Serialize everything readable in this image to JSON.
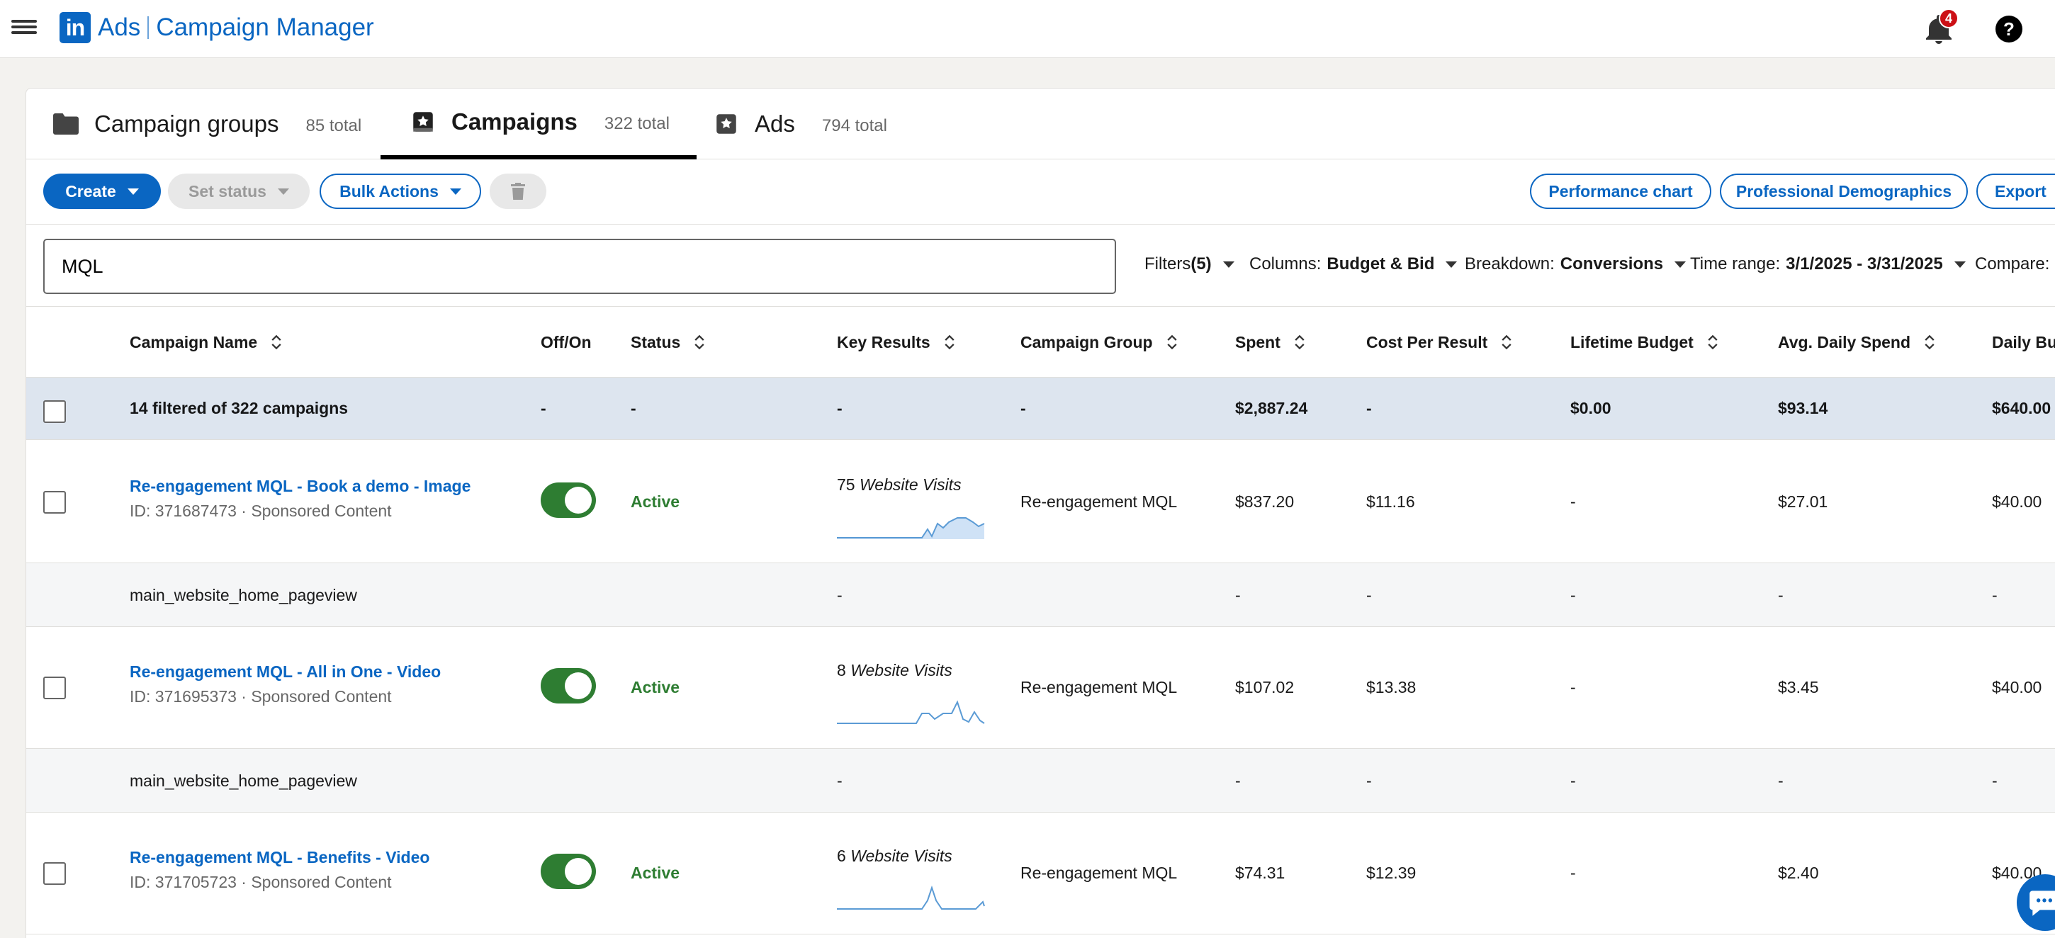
{
  "app": {
    "logo_text": "in",
    "product": "Ads",
    "name": "Campaign Manager",
    "notifications_count": "4",
    "help_label": "?"
  },
  "tabs": [
    {
      "label": "Campaign groups",
      "count": "85 total",
      "icon": "folder-icon"
    },
    {
      "label": "Campaigns",
      "count": "322 total",
      "icon": "campaign-star-icon"
    },
    {
      "label": "Ads",
      "count": "794 total",
      "icon": "ad-star-icon"
    }
  ],
  "toolbar": {
    "create": "Create",
    "set_status": "Set status",
    "bulk_actions": "Bulk Actions",
    "performance_chart": "Performance chart",
    "professional_demographics": "Professional Demographics",
    "export": "Export"
  },
  "filters": {
    "search_value": "MQL",
    "filters_label": "Filters",
    "filters_count": "(5)",
    "columns_label": "Columns:",
    "columns_value": "Budget & Bid",
    "breakdown_label": "Breakdown:",
    "breakdown_value": "Conversions",
    "time_range_label": "Time range:",
    "time_range_value": "3/1/2025 - 3/31/2025",
    "compare_label": "Compare:"
  },
  "table": {
    "headers": {
      "campaign_name": "Campaign Name",
      "off_on": "Off/On",
      "status": "Status",
      "key_results": "Key Results",
      "campaign_group": "Campaign Group",
      "spent": "Spent",
      "cost_per_result": "Cost Per Result",
      "lifetime_budget": "Lifetime Budget",
      "avg_daily_spend": "Avg. Daily Spend",
      "daily_budget": "Daily Bu"
    },
    "summary": {
      "name": "14 filtered of 322 campaigns",
      "off_on": "-",
      "status": "-",
      "key_results": "-",
      "campaign_group": "-",
      "spent": "$2,887.24",
      "cost_per_result": "-",
      "lifetime_budget": "$0.00",
      "avg_daily_spend": "$93.14",
      "daily_budget": "$640.00"
    },
    "rows": [
      {
        "name": "Re-engagement MQL - Book a demo - Image",
        "meta": "ID: 371687473 · Sponsored Content",
        "status": "Active",
        "kr_count": "75",
        "kr_label": "Website Visits",
        "campaign_group": "Re-engagement MQL",
        "spent": "$837.20",
        "cost_per_result": "$11.16",
        "lifetime_budget": "-",
        "avg_daily_spend": "$27.01",
        "daily_budget": "$40.00",
        "sub_name": "main_website_home_pageview",
        "sub_values": {
          "key_results": "-",
          "spent": "-",
          "cost_per_result": "-",
          "lifetime_budget": "-",
          "avg_daily_spend": "-",
          "daily_budget": "-"
        }
      },
      {
        "name": "Re-engagement MQL - All in One - Video",
        "meta": "ID: 371695373 · Sponsored Content",
        "status": "Active",
        "kr_count": "8",
        "kr_label": "Website Visits",
        "campaign_group": "Re-engagement MQL",
        "spent": "$107.02",
        "cost_per_result": "$13.38",
        "lifetime_budget": "-",
        "avg_daily_spend": "$3.45",
        "daily_budget": "$40.00",
        "sub_name": "main_website_home_pageview",
        "sub_values": {
          "key_results": "-",
          "spent": "-",
          "cost_per_result": "-",
          "lifetime_budget": "-",
          "avg_daily_spend": "-",
          "daily_budget": "-"
        }
      },
      {
        "name": "Re-engagement MQL - Benefits - Video",
        "meta": "ID: 371705723 · Sponsored Content",
        "status": "Active",
        "kr_count": "6",
        "kr_label": "Website Visits",
        "campaign_group": "Re-engagement MQL",
        "spent": "$74.31",
        "cost_per_result": "$12.39",
        "lifetime_budget": "-",
        "avg_daily_spend": "$2.40",
        "daily_budget": "$40.00"
      }
    ]
  },
  "colors": {
    "brand": "#0a66c2",
    "active": "#2e7d32",
    "summary_row_bg": "#dde5ef",
    "sub_row_bg": "#f5f6f7",
    "badge": "#cc1016"
  }
}
